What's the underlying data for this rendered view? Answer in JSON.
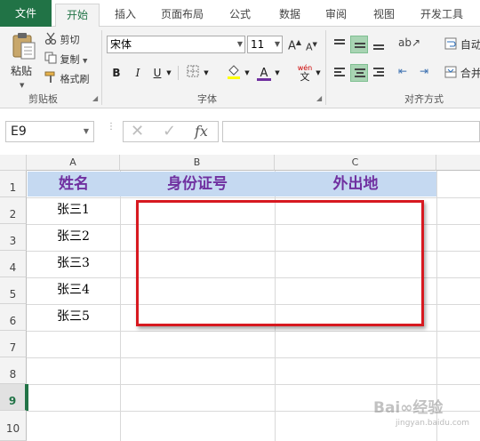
{
  "ribbon_tabs": [
    "文件",
    "开始",
    "插入",
    "页面布局",
    "公式",
    "数据",
    "审阅",
    "视图",
    "开发工具"
  ],
  "clipboard": {
    "paste": "粘贴",
    "cut": "剪切",
    "copy": "复制",
    "format_painter": "格式刷",
    "group_label": "剪贴板"
  },
  "font": {
    "name": "宋体",
    "size": "11",
    "grow": "A",
    "shrink": "A",
    "bold": "B",
    "italic": "I",
    "underline": "U",
    "font_color_glyph": "A",
    "phonetic": "wén",
    "phonetic_char": "文",
    "group_label": "字体"
  },
  "alignment": {
    "wrap_text": "自动",
    "merge": "合并",
    "group_label": "对齐方式"
  },
  "formula_bar": {
    "name_box": "E9",
    "cancel": "✕",
    "enter": "✓",
    "fx": "fx",
    "formula": ""
  },
  "columns": [
    "A",
    "B",
    "C"
  ],
  "rows": [
    "1",
    "2",
    "3",
    "4",
    "5",
    "6",
    "7",
    "8",
    "9",
    "10"
  ],
  "selected_row": "9",
  "header_row": [
    "姓名",
    "身份证号",
    "外出地"
  ],
  "names": [
    "张三1",
    "张三2",
    "张三3",
    "张三4",
    "张三5"
  ],
  "watermark": {
    "text": "Bai∞经验",
    "sub": "jingyan.baidu.com"
  },
  "colors": {
    "excel_green": "#217346",
    "header_fill": "#c5d9f1",
    "header_text": "#7030a0",
    "highlight_box": "#d71920",
    "font_color_bar": "#7030a0"
  }
}
